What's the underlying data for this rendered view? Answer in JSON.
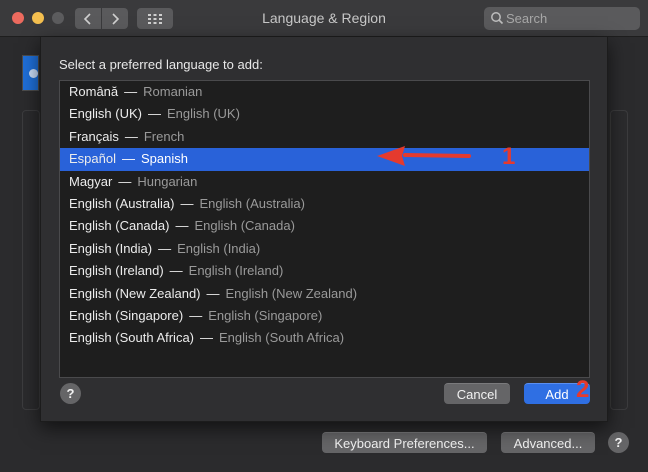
{
  "window": {
    "title": "Language & Region"
  },
  "search": {
    "placeholder": "Search"
  },
  "sheet": {
    "prompt": "Select a preferred language to add:",
    "languages": [
      {
        "native": "Română",
        "english": "Romanian",
        "selected": false
      },
      {
        "native": "English (UK)",
        "english": "English (UK)",
        "selected": false
      },
      {
        "native": "Français",
        "english": "French",
        "selected": false
      },
      {
        "native": "Español",
        "english": "Spanish",
        "selected": true
      },
      {
        "native": "Magyar",
        "english": "Hungarian",
        "selected": false
      },
      {
        "native": "English (Australia)",
        "english": "English (Australia)",
        "selected": false
      },
      {
        "native": "English (Canada)",
        "english": "English (Canada)",
        "selected": false
      },
      {
        "native": "English (India)",
        "english": "English (India)",
        "selected": false
      },
      {
        "native": "English (Ireland)",
        "english": "English (Ireland)",
        "selected": false
      },
      {
        "native": "English (New Zealand)",
        "english": "English (New Zealand)",
        "selected": false
      },
      {
        "native": "English (Singapore)",
        "english": "English (Singapore)",
        "selected": false
      },
      {
        "native": "English (South Africa)",
        "english": "English (South Africa)",
        "selected": false
      }
    ],
    "separator": "—",
    "help_label": "?",
    "cancel_label": "Cancel",
    "add_label": "Add"
  },
  "footer": {
    "keyboard_prefs_label": "Keyboard Preferences...",
    "advanced_label": "Advanced...",
    "help_label": "?"
  },
  "annotations": {
    "step1": "1",
    "step2": "2"
  },
  "colors": {
    "selection": "#2962d9",
    "add_button": "#2f6fe3",
    "annotation": "#e53a2e"
  }
}
